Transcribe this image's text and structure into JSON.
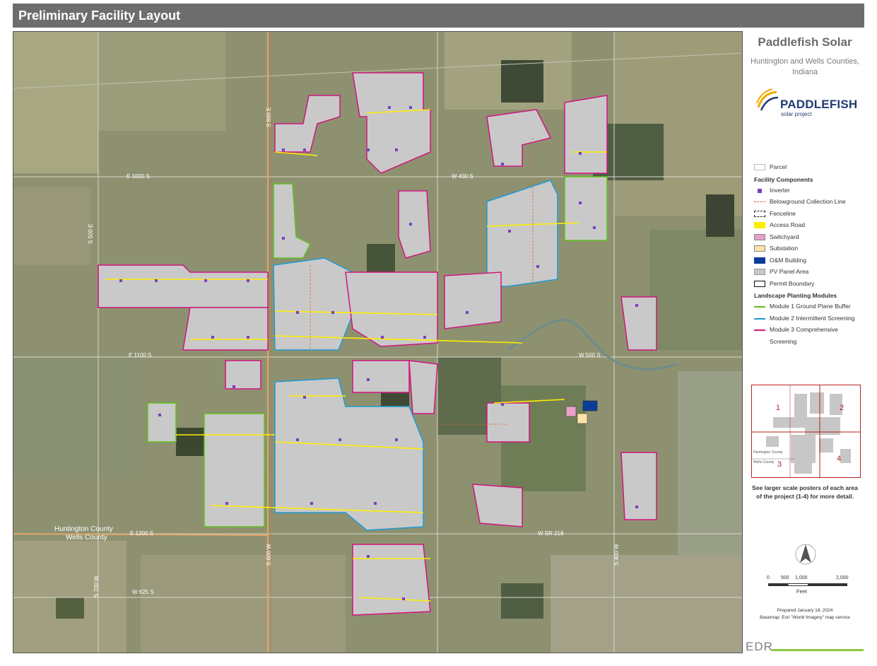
{
  "page_title": "Preliminary Facility Layout",
  "project": {
    "name": "Paddlefish Solar",
    "location": "Huntington and Wells Counties, Indiana",
    "logo_word": "PADDLEFISH",
    "logo_sub": "solar project"
  },
  "colors": {
    "title_bar": "#6d6d6d",
    "pv_panel": "#c9c9c9",
    "access_road": "#ffee00",
    "module1": "#5fc21a",
    "module2": "#1e9ad6",
    "module3": "#d0157f",
    "inverter": "#7b3fbf",
    "collection_line": "#e06a2c",
    "switchyard": "#e7a0c8",
    "substation": "#fde3a7",
    "om_building": "#0a3d9a",
    "inset_border": "#b22222",
    "edr_accent": "#8dc63f"
  },
  "legend": {
    "parcel": "Parcel",
    "facility_heading": "Facility Components",
    "inverter": "Inverter",
    "collection_line": "Belowground Collection Line",
    "fenceline": "Fenceline",
    "access_road": "Access Road",
    "switchyard": "Switchyard",
    "substation": "Substation",
    "om_building": "O&M Building",
    "pv_panel": "PV Panel Area",
    "permit_boundary": "Permit Boundary",
    "landscape_heading": "Landscape Planting Modules",
    "module1": "Module 1 Ground Plane Buffer",
    "module2": "Module 2 Intermittent Screening",
    "module3": "Module 3 Comprehensive Screening"
  },
  "map_labels": {
    "road_1000s": "E 1000 S",
    "road_w400s": "W 400 S",
    "road_1100s": "E 1100 S",
    "road_w500s": "W 500 S",
    "road_1200s": "E 1200 S",
    "road_sr218": "W SR 218",
    "road_w625s": "W 625 S",
    "road_s500e": "S 500 E",
    "road_s600e": "S 600 E",
    "road_s400w": "S 400 W",
    "road_s600w": "S 600 W",
    "road_s700w": "S 700 W",
    "county_north": "Huntington County",
    "county_south": "Wells County"
  },
  "inset": {
    "areas": [
      "1",
      "2",
      "3",
      "4"
    ],
    "county_north": "Huntington County",
    "county_south": "Wells County",
    "note": "See larger scale posters of each area of the project (1-4) for more detail."
  },
  "scale": {
    "ticks": [
      "0",
      "500",
      "1,000",
      "2,000"
    ],
    "unit": "Feet"
  },
  "credits": {
    "prepared": "Prepared January 18, 2024",
    "basemap": "Basemap: Esri \"World Imagery\" map service"
  },
  "brand": "EDR"
}
